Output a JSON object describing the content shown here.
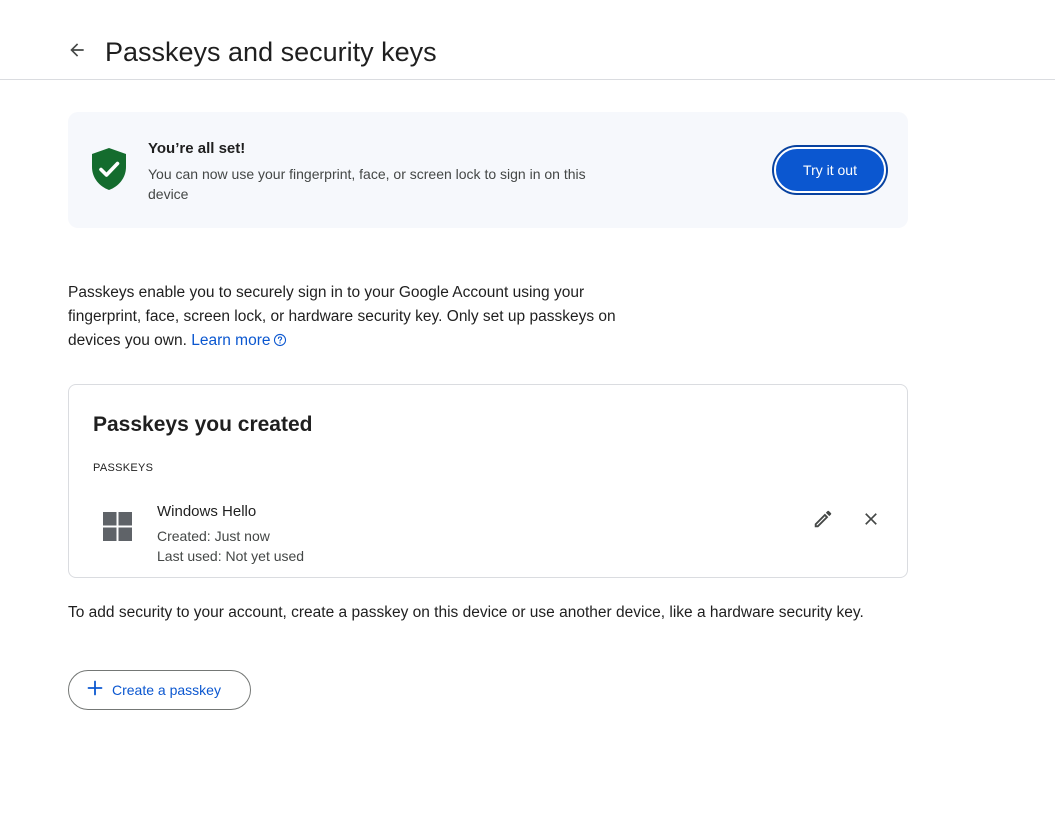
{
  "header": {
    "title": "Passkeys and security keys",
    "back_icon": "arrow-back-icon"
  },
  "banner": {
    "icon": "shield-check-icon",
    "title": "You’re all set!",
    "description": "You can now use your fingerprint, face, or screen lock to sign in on this device",
    "button_label": "Try it out"
  },
  "intro": {
    "text": "Passkeys enable you to securely sign in to your Google Account using your fingerprint, face, screen lock, or hardware security key. Only set up passkeys on devices you own. ",
    "link_label": "Learn more",
    "link_icon": "help-circle-icon"
  },
  "card": {
    "title": "Passkeys you created",
    "section_label": "PASSKEYS",
    "passkeys": [
      {
        "name": "Windows Hello",
        "created": "Created: Just now",
        "last_used": "Last used: Not yet used",
        "icon": "windows-logo-icon"
      }
    ],
    "edit_icon": "pencil-icon",
    "delete_icon": "close-icon"
  },
  "footer": {
    "text": "To add security to your account, create a passkey on this device or use another device, like a hardware security key.",
    "create_button_label": "Create a passkey",
    "create_icon": "plus-icon"
  },
  "colors": {
    "accent": "#0b57d0",
    "shield_green": "#146c2e",
    "banner_bg": "#f6f8fc",
    "border": "#dadce0"
  }
}
